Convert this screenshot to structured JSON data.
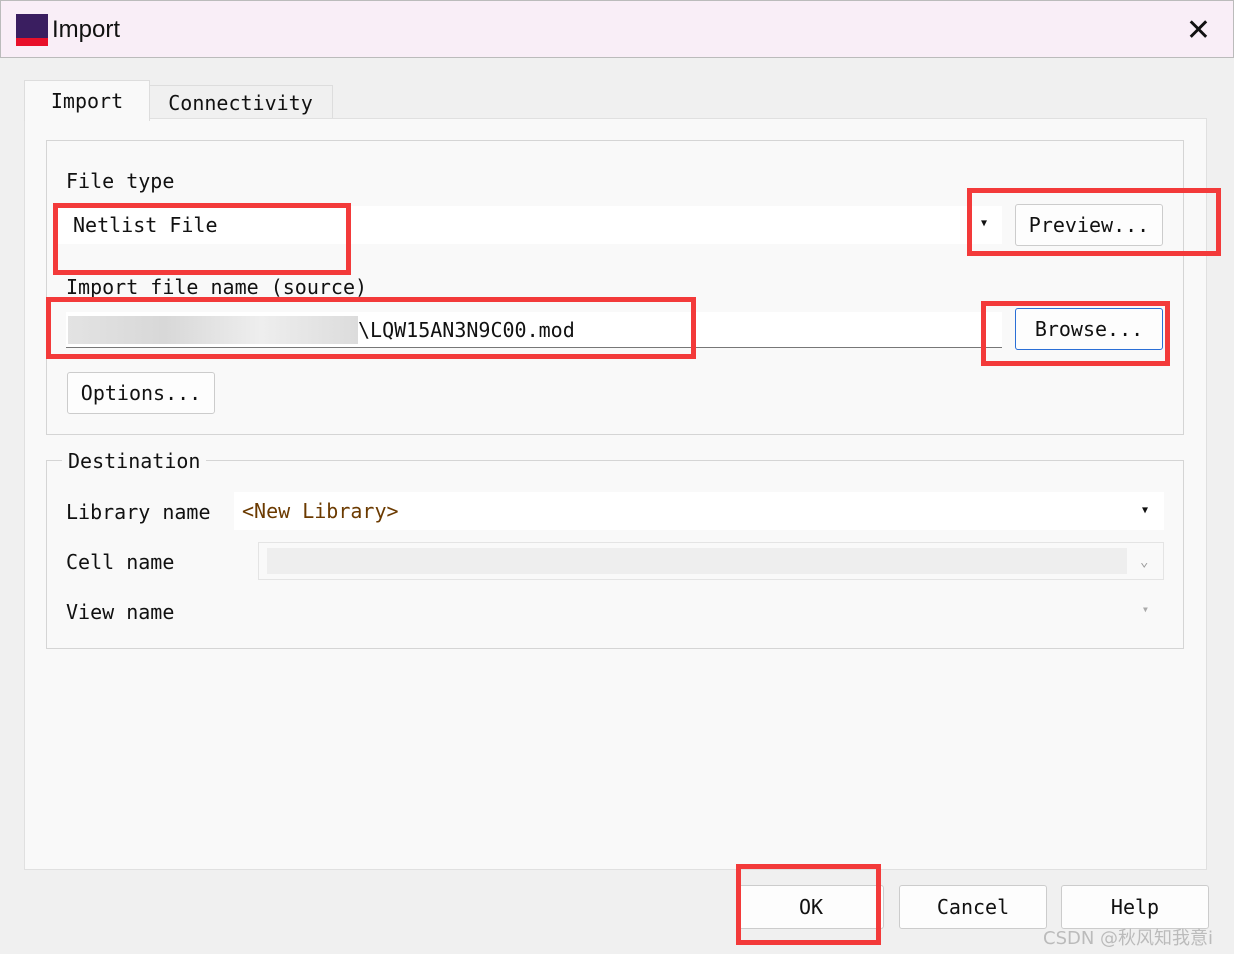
{
  "window": {
    "title": "Import",
    "close_icon": "close-icon"
  },
  "tabs": [
    {
      "label": "Import",
      "active": true
    },
    {
      "label": "Connectivity",
      "active": false
    }
  ],
  "source": {
    "file_type_label": "File type",
    "file_type_value": "Netlist File",
    "preview_button": "Preview...",
    "import_file_label": "Import file name (source)",
    "import_file_value": "\\LQW15AN3N9C00.mod",
    "browse_button": "Browse...",
    "options_button": "Options..."
  },
  "destination": {
    "legend": "Destination",
    "library_label": "Library name",
    "library_value": "<New Library>",
    "cell_label": "Cell name",
    "cell_value": "",
    "view_label": "View name",
    "view_value": ""
  },
  "footer": {
    "ok": "OK",
    "cancel": "Cancel",
    "help": "Help"
  },
  "watermark": "CSDN @秋风知我意i",
  "highlight_color": "#f33a3a"
}
